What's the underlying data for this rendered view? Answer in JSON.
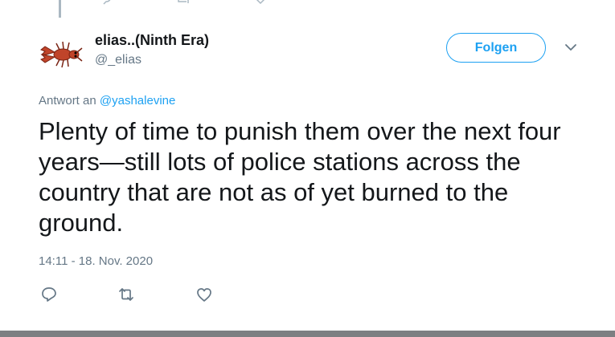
{
  "author": {
    "display_name": "elias..(Ninth Era)",
    "handle": "@_elias",
    "avatar_icon": "lobster-avatar"
  },
  "follow_button": {
    "label": "Folgen"
  },
  "menu": {
    "icon": "chevron-down-icon"
  },
  "reply_context": {
    "prefix": "Antwort an",
    "mention": "@yashalevine"
  },
  "tweet": {
    "text": "Plenty of time to punish them over the next four years—still lots of police stations across the country that are not as of yet burned to the ground.",
    "timestamp": "14:11 - 18. Nov. 2020"
  },
  "actions": [
    {
      "name": "reply",
      "icon": "reply-icon"
    },
    {
      "name": "retweet",
      "icon": "retweet-icon"
    },
    {
      "name": "like",
      "icon": "heart-icon"
    }
  ],
  "colors": {
    "accent": "#1da1f2",
    "secondary_text": "#657786",
    "primary_text": "#14171a",
    "icon_gray": "#657786"
  }
}
